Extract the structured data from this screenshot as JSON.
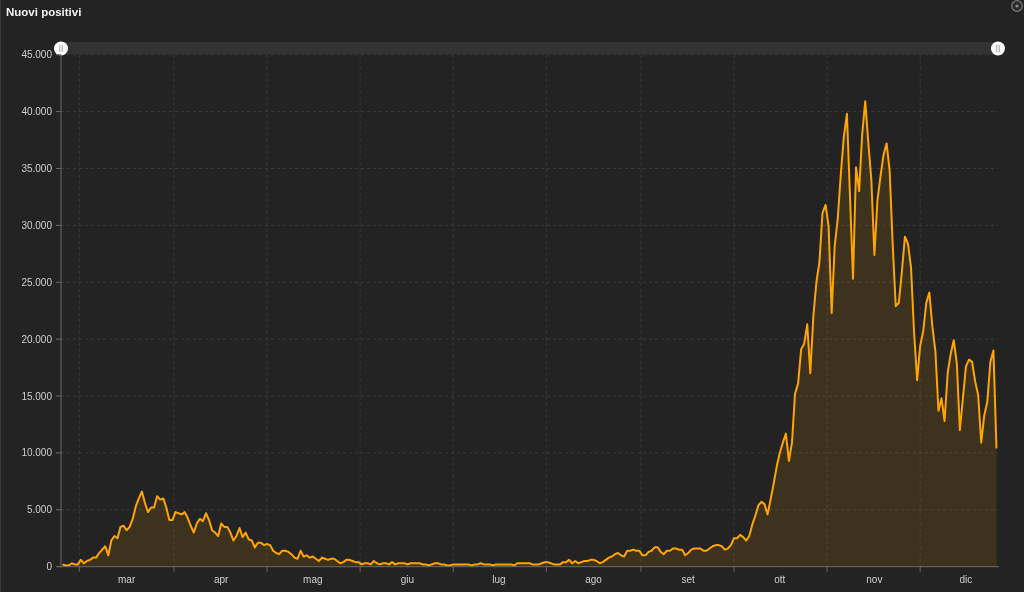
{
  "chart": {
    "range_slider": {
      "handles": [
        {
          "level": 0
        },
        {
          "level": 1
        }
      ]
    },
    "chart_data": {
      "type": "area",
      "title": "Nuovi positivi",
      "grid": true,
      "categories": [
        null,
        null,
        null,
        null,
        null,
        null,
        null,
        null,
        null,
        null,
        null,
        null,
        null,
        null,
        null,
        null,
        null,
        null,
        null,
        null,
        null,
        "mar",
        null,
        null,
        null,
        null,
        null,
        null,
        null,
        null,
        null,
        null,
        null,
        null,
        null,
        null,
        null,
        null,
        null,
        null,
        null,
        null,
        null,
        null,
        null,
        null,
        null,
        null,
        null,
        null,
        null,
        null,
        "apr",
        null,
        null,
        null,
        null,
        null,
        null,
        null,
        null,
        null,
        null,
        null,
        null,
        null,
        null,
        null,
        null,
        null,
        null,
        null,
        null,
        null,
        null,
        null,
        null,
        null,
        null,
        null,
        null,
        null,
        "mag",
        null,
        null,
        null,
        null,
        null,
        null,
        null,
        null,
        null,
        null,
        null,
        null,
        null,
        null,
        null,
        null,
        null,
        null,
        null,
        null,
        null,
        null,
        null,
        null,
        null,
        null,
        null,
        null,
        null,
        null,
        "giu",
        null,
        null,
        null,
        null,
        null,
        null,
        null,
        null,
        null,
        null,
        null,
        null,
        null,
        null,
        null,
        null,
        null,
        null,
        null,
        null,
        null,
        null,
        null,
        null,
        null,
        null,
        null,
        null,
        null,
        "lug",
        null,
        null,
        null,
        null,
        null,
        null,
        null,
        null,
        null,
        null,
        null,
        null,
        null,
        null,
        null,
        null,
        null,
        null,
        null,
        null,
        null,
        null,
        null,
        null,
        null,
        null,
        null,
        null,
        null,
        null,
        "ago",
        null,
        null,
        null,
        null,
        null,
        null,
        null,
        null,
        null,
        null,
        null,
        null,
        null,
        null,
        null,
        null,
        null,
        null,
        null,
        null,
        null,
        null,
        null,
        null,
        null,
        null,
        null,
        null,
        null,
        null,
        "set",
        null,
        null,
        null,
        null,
        null,
        null,
        null,
        null,
        null,
        null,
        null,
        null,
        null,
        null,
        null,
        null,
        null,
        null,
        null,
        null,
        null,
        null,
        null,
        null,
        null,
        null,
        null,
        null,
        null,
        "ott",
        null,
        null,
        null,
        null,
        null,
        null,
        null,
        null,
        null,
        null,
        null,
        null,
        null,
        null,
        null,
        null,
        null,
        null,
        null,
        null,
        null,
        null,
        null,
        null,
        null,
        null,
        null,
        null,
        null,
        null,
        "nov",
        null,
        null,
        null,
        null,
        null,
        null,
        null,
        null,
        null,
        null,
        null,
        null,
        null,
        null,
        null,
        null,
        null,
        null,
        null,
        null,
        null,
        null,
        null,
        null,
        null,
        null,
        null,
        null,
        null,
        "dic",
        null,
        null,
        null,
        null,
        null,
        null,
        null,
        null,
        null,
        null
      ],
      "series": [
        {
          "color": "#ffa500",
          "values": [
            200,
            100,
            100,
            300,
            200,
            200,
            600,
            300,
            500,
            600,
            800,
            800,
            1200,
            1500,
            1800,
            1000,
            2300,
            2700,
            2500,
            3500,
            3600,
            3200,
            3500,
            4200,
            5300,
            6000,
            6600,
            5600,
            4800,
            5200,
            5200,
            6200,
            5900,
            6000,
            5200,
            4100,
            4100,
            4800,
            4700,
            4600,
            4800,
            4300,
            3600,
            3000,
            3800,
            4200,
            4000,
            4700,
            4100,
            3200,
            3000,
            2700,
            3800,
            3500,
            3500,
            3000,
            2300,
            2700,
            3400,
            2600,
            3000,
            2400,
            2300,
            1700,
            2100,
            2100,
            1900,
            2000,
            1900,
            1400,
            1200,
            1100,
            1400,
            1400,
            1300,
            1100,
            800,
            700,
            1400,
            900,
            1000,
            800,
            900,
            700,
            500,
            800,
            700,
            600,
            700,
            700,
            500,
            300,
            400,
            600,
            600,
            500,
            400,
            400,
            200,
            300,
            300,
            200,
            500,
            300,
            200,
            300,
            300,
            200,
            400,
            200,
            300,
            300,
            300,
            200,
            300,
            300,
            300,
            300,
            200,
            200,
            100,
            200,
            300,
            300,
            200,
            200,
            100,
            100,
            200,
            200,
            200,
            200,
            200,
            200,
            100,
            200,
            200,
            300,
            200,
            200,
            200,
            100,
            200,
            200,
            200,
            200,
            200,
            200,
            100,
            300,
            300,
            300,
            300,
            300,
            200,
            200,
            200,
            300,
            400,
            400,
            300,
            200,
            200,
            200,
            400,
            400,
            600,
            300,
            500,
            300,
            400,
            500,
            500,
            600,
            600,
            500,
            300,
            400,
            600,
            800,
            900,
            1100,
            1200,
            1000,
            900,
            1400,
            1400,
            1500,
            1400,
            1400,
            1000,
            1000,
            1300,
            1400,
            1700,
            1700,
            1300,
            1100,
            1400,
            1400,
            1600,
            1600,
            1500,
            1500,
            1000,
            1200,
            1500,
            1600,
            1600,
            1600,
            1400,
            1400,
            1600,
            1800,
            1900,
            1900,
            1800,
            1500,
            1600,
            1900,
            2500,
            2500,
            2800,
            2600,
            2300,
            2700,
            3700,
            4500,
            5400,
            5700,
            5500,
            4600,
            5900,
            7300,
            8800,
            10000,
            10900,
            11700,
            9300,
            10900,
            15200,
            16100,
            19100,
            19600,
            21300,
            17000,
            22000,
            25000,
            26800,
            31100,
            31800,
            29900,
            22300,
            28200,
            30600,
            34500,
            37800,
            39800,
            32600,
            25300,
            35100,
            33000,
            38000,
            40900,
            37300,
            34000,
            27400,
            32200,
            34300,
            36200,
            37200,
            34800,
            28300,
            22900,
            23200,
            25900,
            29000,
            28400,
            26300,
            20600,
            16400,
            19400,
            20700,
            23200,
            24100,
            21100,
            18900,
            13700,
            14800,
            12800,
            17000,
            18700,
            19900,
            17900,
            12000,
            14800,
            17600,
            18200,
            18000,
            16300,
            15100,
            10900,
            13300,
            14500,
            18000,
            19000,
            10400
          ]
        }
      ],
      "ylim": [
        0,
        45000
      ],
      "yticks": [
        {
          "value": 0,
          "label": "0"
        },
        {
          "value": 5000,
          "label": "5.000"
        },
        {
          "value": 10000,
          "label": "10.000"
        },
        {
          "value": 15000,
          "label": "15.000"
        },
        {
          "value": 20000,
          "label": "20.000"
        },
        {
          "value": 25000,
          "label": "25.000"
        },
        {
          "value": 30000,
          "label": "30.000"
        },
        {
          "value": 35000,
          "label": "35.000"
        },
        {
          "value": 40000,
          "label": "40.000"
        },
        {
          "value": 45000,
          "label": "45.000"
        }
      ]
    }
  }
}
